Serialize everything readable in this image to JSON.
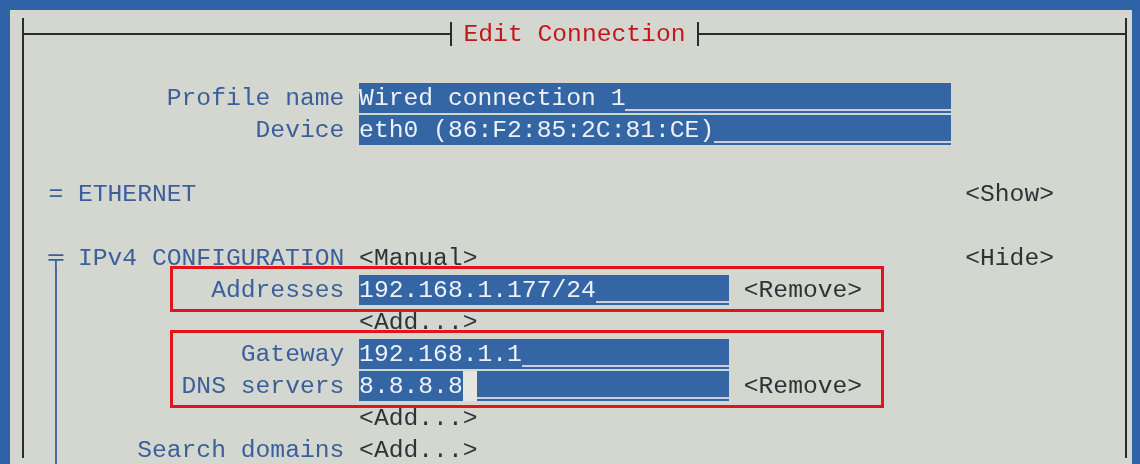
{
  "dialog": {
    "title": "Edit Connection"
  },
  "fields": [
    {
      "label": "Profile name",
      "value": "Wired connection 1"
    },
    {
      "label": "Device",
      "value": "eth0 (86:F2:85:2C:81:CE)"
    }
  ],
  "sections": [
    {
      "marker": "=",
      "title": "ETHERNET",
      "toggle": "<Show>",
      "expanded": false
    },
    {
      "marker": "╤",
      "title": "IPv4 CONFIGURATION",
      "mode": "<Manual>",
      "toggle": "<Hide>",
      "expanded": true,
      "rows": [
        {
          "kind": "entry",
          "label": "Addresses",
          "value": "192.168.1.177/24",
          "remove": "<Remove>",
          "highlighted": true
        },
        {
          "kind": "add",
          "button": "<Add...>"
        },
        {
          "kind": "entry",
          "label": "Gateway",
          "value": "192.168.1.1",
          "highlighted": true
        },
        {
          "kind": "entry",
          "label": "DNS servers",
          "value": "8.8.8.8",
          "focused": true,
          "remove": "<Remove>",
          "highlighted": true
        },
        {
          "kind": "add",
          "button": "<Add...>"
        },
        {
          "kind": "add",
          "label": "Search domains",
          "button": "<Add...>"
        }
      ]
    }
  ]
}
